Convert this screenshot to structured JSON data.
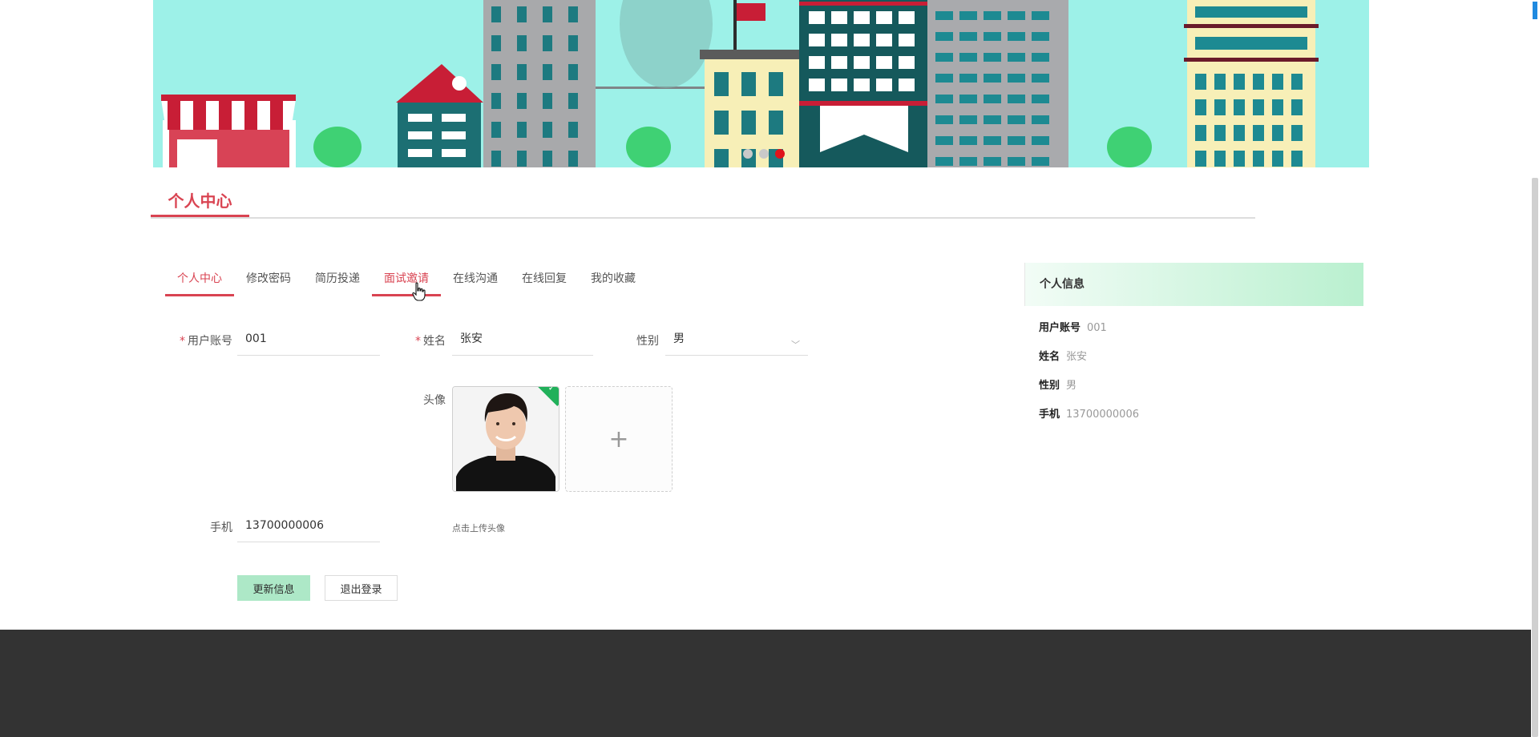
{
  "section": {
    "title": "个人中心"
  },
  "tabs": [
    {
      "label": "个人中心",
      "state": "active"
    },
    {
      "label": "修改密码"
    },
    {
      "label": "简历投递"
    },
    {
      "label": "面试邀请",
      "state": "hover"
    },
    {
      "label": "在线沟通"
    },
    {
      "label": "在线回复"
    },
    {
      "label": "我的收藏"
    }
  ],
  "form": {
    "required_mark": "*",
    "account": {
      "label": "用户账号",
      "value": "001"
    },
    "name": {
      "label": "姓名",
      "value": "张安"
    },
    "gender": {
      "label": "性别",
      "value": "男",
      "icon": "chevron-down-icon"
    },
    "avatar": {
      "label": "头像",
      "upload_icon": "plus-icon",
      "hint": "点击上传头像"
    },
    "phone": {
      "label": "手机",
      "value": "13700000006"
    },
    "buttons": {
      "update": "更新信息",
      "logout": "退出登录"
    }
  },
  "info_panel": {
    "title": "个人信息",
    "rows": [
      {
        "key": "用户账号",
        "value": "001"
      },
      {
        "key": "姓名",
        "value": "张安"
      },
      {
        "key": "性别",
        "value": "男"
      },
      {
        "key": "手机",
        "value": "13700000006"
      }
    ]
  },
  "colors": {
    "accent": "#d94452",
    "update_button": "#ade8c7",
    "footer": "#333333",
    "banner_sky": "#9df1e8"
  },
  "carousel": {
    "slides": 3,
    "active_slide": 3
  }
}
